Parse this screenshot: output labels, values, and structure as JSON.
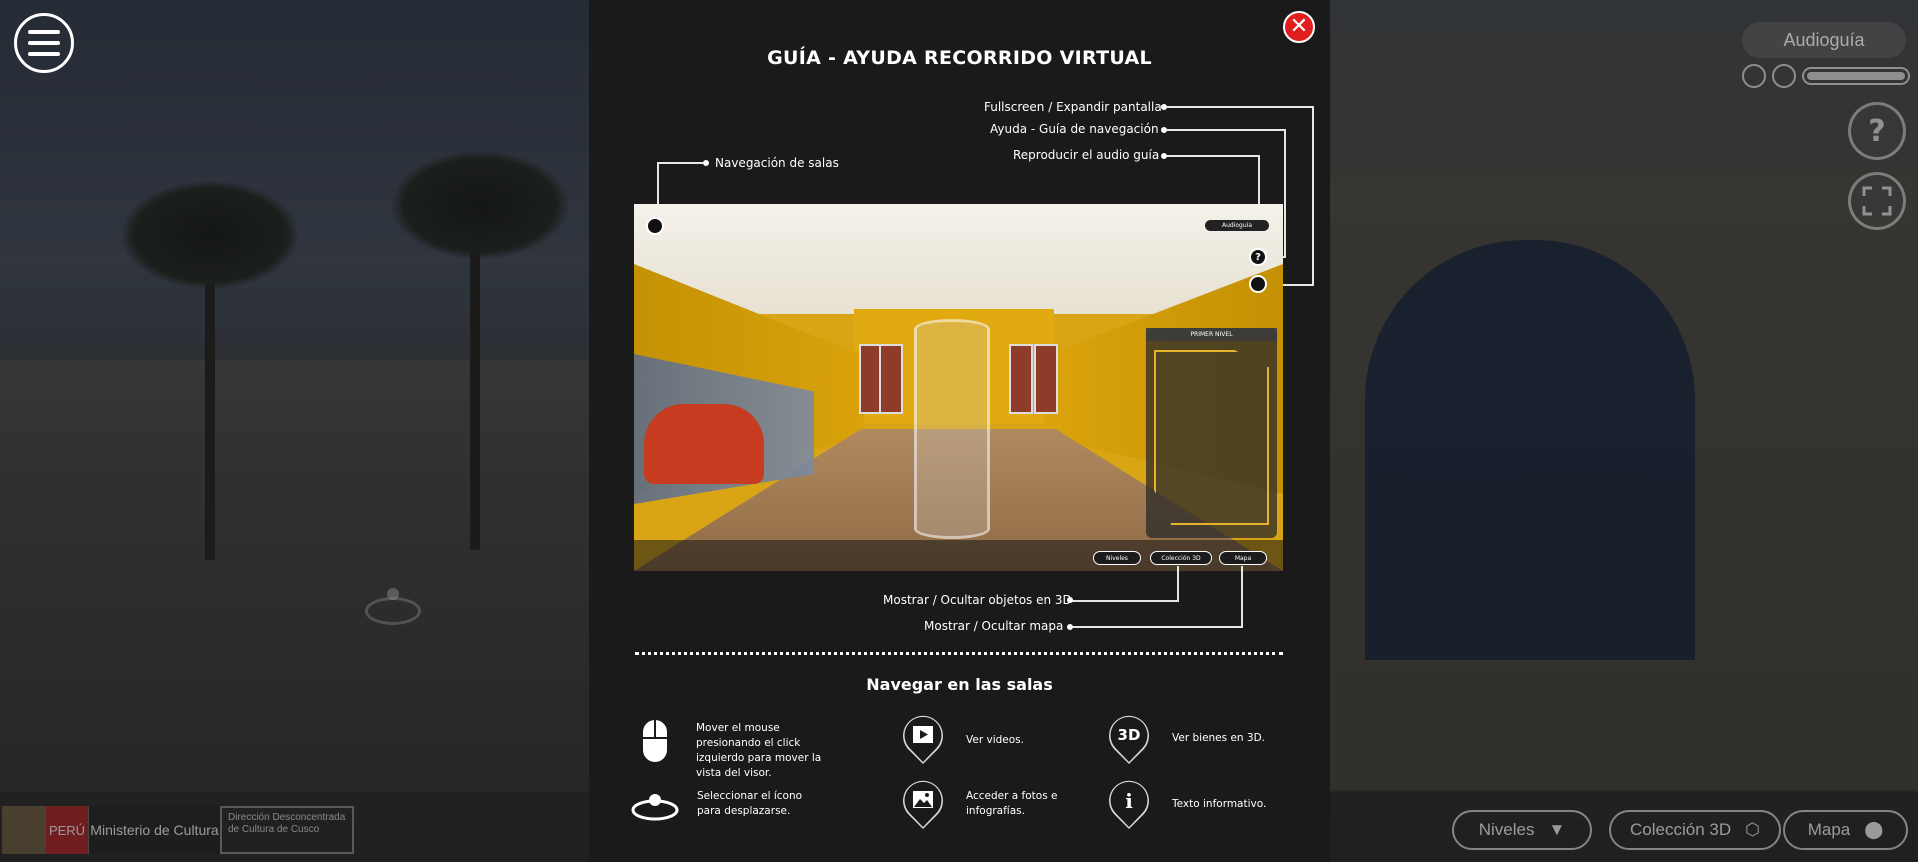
{
  "menu": {
    "icon": "hamburger-icon"
  },
  "audio_panel": {
    "label": "Audioguía"
  },
  "side_buttons": {
    "help_icon_text": "?",
    "fullscreen_icon": "expand-icon"
  },
  "bottom": {
    "logo": {
      "peru": "PERÚ",
      "ministry": "Ministerio de Cultura",
      "direction": "Dirección Desconcentrada de Cultura de Cusco"
    },
    "niveles": "Niveles",
    "coleccion": "Colección 3D",
    "mapa": "Mapa"
  },
  "modal": {
    "title": "GUÍA - AYUDA RECORRIDO VIRTUAL",
    "close_symbol": "✕",
    "callouts": {
      "fullscreen": "Fullscreen / Expandir pantalla",
      "ayuda": "Ayuda - Guía de navegación",
      "audio": "Reproducir el audio guía",
      "navegacion": "Navegación de salas",
      "objetos3d": "Mostrar / Ocultar objetos en 3D",
      "mapa": "Mostrar / Ocultar mapa"
    },
    "preview": {
      "audio_label": "Audioguía",
      "map_title": "PRIMER NIVEL",
      "help_symbol": "?",
      "pill_niveles": "Niveles",
      "pill_coleccion": "Colección 3D",
      "pill_mapa": "Mapa"
    },
    "section_title": "Navegar en las salas",
    "help_items": {
      "mouse": "Mover el mouse presionando el click izquierdo para mover la vista del visor.",
      "hotspot": "Seleccionar el ícono para desplazarse.",
      "videos": "Ver videos.",
      "fotos": "Acceder a fotos e infografías.",
      "bienes3d_icon": "3D",
      "bienes3d": "Ver bienes en 3D.",
      "info_icon": "i",
      "info": "Texto informativo."
    }
  }
}
